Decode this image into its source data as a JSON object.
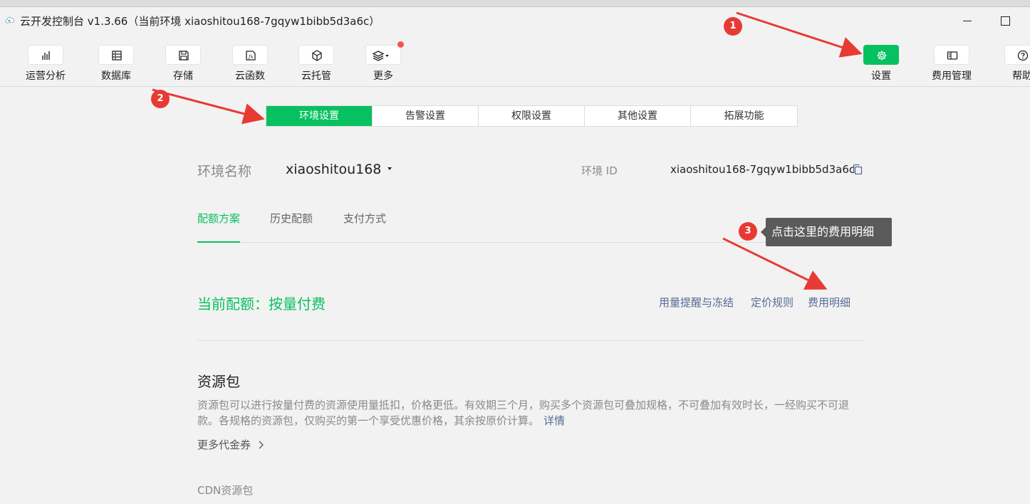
{
  "window": {
    "title": "云开发控制台 v1.3.66（当前环境 xiaoshitou168-7gqyw1bibb5d3a6c）"
  },
  "toolbar": {
    "items": [
      {
        "label": "运营分析",
        "icon": "bar-chart-icon"
      },
      {
        "label": "数据库",
        "icon": "database-icon"
      },
      {
        "label": "存储",
        "icon": "save-icon"
      },
      {
        "label": "云函数",
        "icon": "function-icon"
      },
      {
        "label": "云托管",
        "icon": "cube-icon"
      },
      {
        "label": "更多",
        "icon": "layers-icon"
      }
    ],
    "right_items": [
      {
        "label": "设置",
        "icon": "gear-icon"
      },
      {
        "label": "费用管理",
        "icon": "billing-icon"
      },
      {
        "label": "帮助",
        "icon": "help-icon"
      }
    ]
  },
  "settings_tabs": [
    "环境设置",
    "告警设置",
    "权限设置",
    "其他设置",
    "拓展功能"
  ],
  "env": {
    "name_label": "环境名称",
    "name_value": "xiaoshitou168",
    "id_label": "环境 ID",
    "id_value": "xiaoshitou168-7gqyw1bibb5d3a6c"
  },
  "quota_tabs": [
    "配额方案",
    "历史配额",
    "支付方式"
  ],
  "quota": {
    "current": "当前配额：按量付费",
    "links": [
      "用量提醒与冻结",
      "定价规则",
      "费用明细"
    ]
  },
  "resource": {
    "title": "资源包",
    "description": "资源包可以进行按量付费的资源使用量抵扣，价格更低。有效期三个月，购买多个资源包可叠加规格，不可叠加有效时长，一经购买不可退款。各规格的资源包，仅购买的第一个享受优惠价格，其余按原价计算。",
    "detail_link": "详情",
    "more_coupons": "更多代金券",
    "cdn_title": "CDN资源包"
  },
  "annotations": {
    "badges": [
      "1",
      "2",
      "3"
    ],
    "tooltip": "点击这里的费用明细"
  },
  "colors": {
    "accent": "#07c160",
    "link": "#576b95",
    "annotation": "#e83a34",
    "tooltip_bg": "#5a5a5a"
  }
}
